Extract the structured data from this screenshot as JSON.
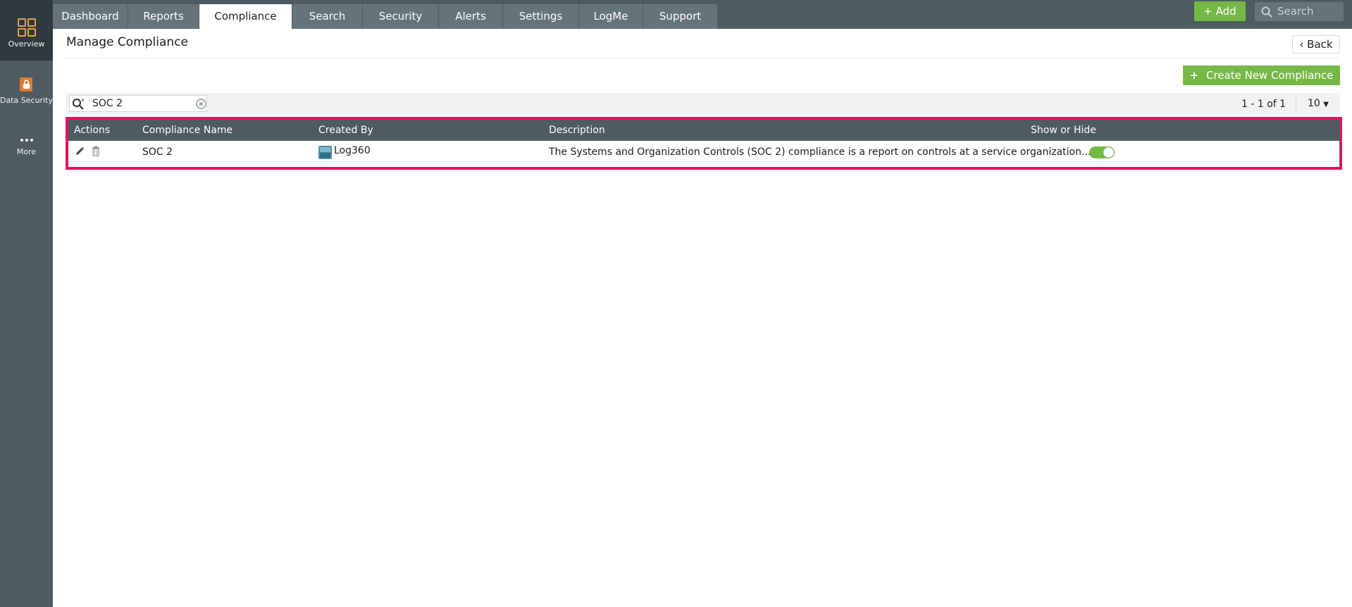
{
  "sidebar": {
    "items": [
      {
        "label": "Overview",
        "icon": "grid-icon"
      },
      {
        "label": "Data Security",
        "icon": "lock-document-icon"
      },
      {
        "label": "More",
        "icon": "more-dots-icon"
      }
    ]
  },
  "nav": {
    "tabs": [
      {
        "label": "Dashboard"
      },
      {
        "label": "Reports"
      },
      {
        "label": "Compliance"
      },
      {
        "label": "Search"
      },
      {
        "label": "Security"
      },
      {
        "label": "Alerts"
      },
      {
        "label": "Settings"
      },
      {
        "label": "LogMe"
      },
      {
        "label": "Support"
      }
    ],
    "active_tab": "Compliance",
    "add_label": "+ Add",
    "search_placeholder": "Search"
  },
  "page": {
    "title": "Manage Compliance",
    "back_label": "Back",
    "create_label": "Create New Compliance"
  },
  "filter": {
    "value": "SOC 2"
  },
  "pager": {
    "range": "1 - 1 of 1",
    "page_size": "10"
  },
  "table": {
    "columns": [
      "Actions",
      "Compliance Name",
      "Created By",
      "Description",
      "Show or Hide"
    ],
    "rows": [
      {
        "name": "SOC 2",
        "created_by": "Log360",
        "description": "The Systems and Organization Controls (SOC 2) compliance is a report on controls at a service organization...",
        "visible": true
      }
    ]
  },
  "colors": {
    "rail": "#4f5b62",
    "accent_green": "#76b845",
    "highlight": "#e8135a"
  }
}
